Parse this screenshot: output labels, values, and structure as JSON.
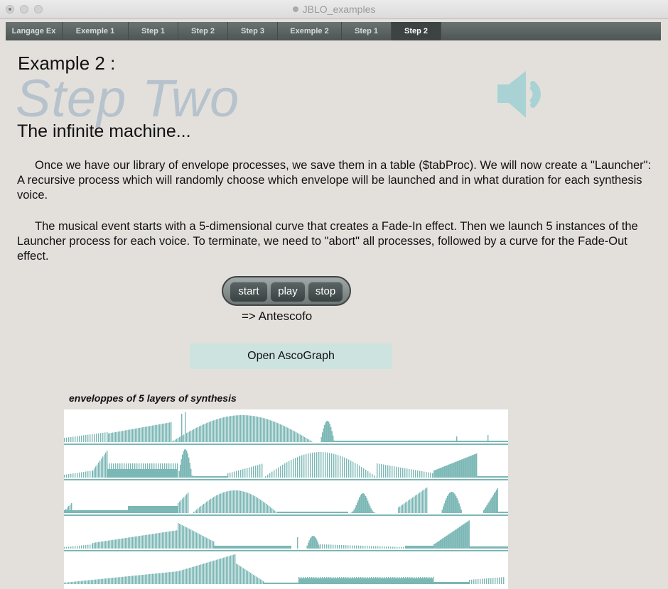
{
  "window": {
    "title": "JBLO_examples"
  },
  "tabs": [
    {
      "label": "Langage Ex",
      "active": false
    },
    {
      "label": "Exemple 1",
      "active": false
    },
    {
      "label": "Step 1",
      "active": false
    },
    {
      "label": "Step 2",
      "active": false
    },
    {
      "label": "Step 3",
      "active": false
    },
    {
      "label": "Exemple 2",
      "active": false
    },
    {
      "label": "Step 1",
      "active": false
    },
    {
      "label": "Step 2",
      "active": true
    }
  ],
  "header": {
    "example": "Example 2 :",
    "step": "Step Two",
    "subtitle": "The infinite machine..."
  },
  "content": {
    "paragraph1": "Once we have our library of envelope processes, we save them in a table ($tabProc). We will now create a \"Launcher\": A recursive process which will randomly choose which envelope will be launched and in what duration for each synthesis voice.",
    "paragraph2": "The musical event starts with a 5-dimensional curve that creates a Fade-In effect. Then we launch 5 instances of the Launcher process for each voice. To terminate, we need to \"abort\" all processes, followed by a curve for the Fade-Out effect."
  },
  "transport": {
    "start": "start",
    "play": "play",
    "stop": "stop",
    "target": "=> Antescofo"
  },
  "open_ascograph": "Open AscoGraph",
  "envelopes": {
    "title": "enveloppes of 5 layers of synthesis",
    "layer_count": 5
  },
  "colors": {
    "accent_teal": "#7ab7b5",
    "tab_bar": "#565d5d",
    "background": "#e3e0dc"
  },
  "icons": {
    "speaker": "speaker-icon"
  }
}
